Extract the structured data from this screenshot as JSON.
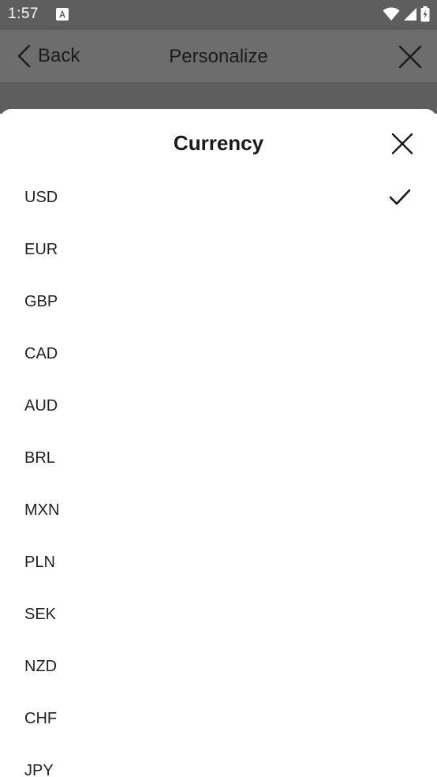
{
  "status_bar": {
    "time": "1:57",
    "notification_icon": "a-badge-icon",
    "icons": [
      "wifi-icon",
      "signal-icon",
      "battery-icon"
    ]
  },
  "app_bar": {
    "back_label": "Back",
    "title": "Personalize",
    "back_icon": "chevron-left-icon",
    "close_icon": "close-icon"
  },
  "sheet": {
    "title": "Currency",
    "close_icon": "close-icon",
    "selected": "USD",
    "items": [
      {
        "label": "USD",
        "selected": true
      },
      {
        "label": "EUR",
        "selected": false
      },
      {
        "label": "GBP",
        "selected": false
      },
      {
        "label": "CAD",
        "selected": false
      },
      {
        "label": "AUD",
        "selected": false
      },
      {
        "label": "BRL",
        "selected": false
      },
      {
        "label": "MXN",
        "selected": false
      },
      {
        "label": "PLN",
        "selected": false
      },
      {
        "label": "SEK",
        "selected": false
      },
      {
        "label": "NZD",
        "selected": false
      },
      {
        "label": "CHF",
        "selected": false
      },
      {
        "label": "JPY",
        "selected": false
      }
    ]
  }
}
